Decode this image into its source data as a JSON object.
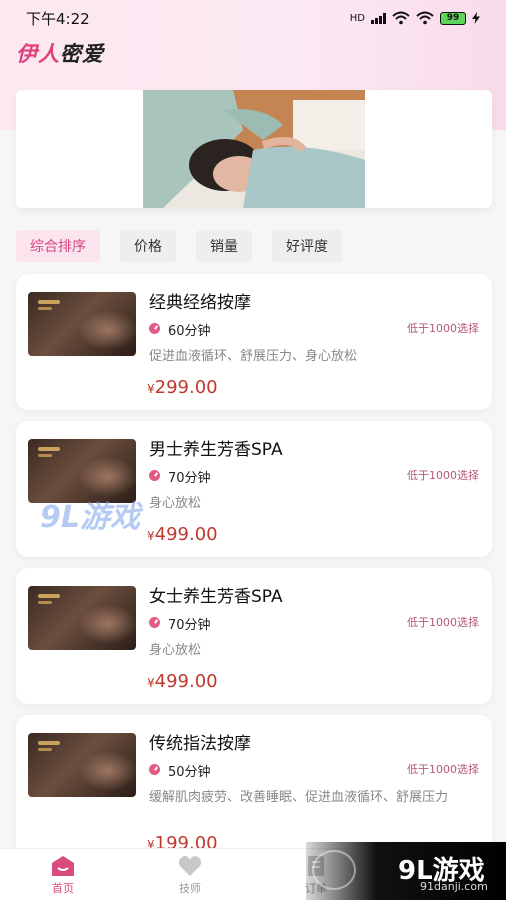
{
  "status": {
    "time": "下午4:22",
    "network": "HD",
    "battery": "99"
  },
  "app": {
    "title_part1": "伊人",
    "title_part2": "密爱"
  },
  "filters": [
    {
      "label": "综合排序",
      "active": true
    },
    {
      "label": "价格",
      "active": false
    },
    {
      "label": "销量",
      "active": false
    },
    {
      "label": "好评度",
      "active": false
    }
  ],
  "services": [
    {
      "name": "经典经络按摩",
      "duration": "60分钟",
      "choose": "低于1000选择",
      "desc": "促进血液循环、舒展压力、身心放松",
      "currency": "¥",
      "price": "299.00"
    },
    {
      "name": "男士养生芳香SPA",
      "duration": "70分钟",
      "choose": "低于1000选择",
      "desc": "身心放松",
      "currency": "¥",
      "price": "499.00"
    },
    {
      "name": "女士养生芳香SPA",
      "duration": "70分钟",
      "choose": "低于1000选择",
      "desc": "身心放松",
      "currency": "¥",
      "price": "499.00"
    },
    {
      "name": "传统指法按摩",
      "duration": "50分钟",
      "choose": "低于1000选择",
      "desc": "缓解肌肉疲劳、改善睡眠、促进血液循环、舒展压力",
      "currency": "¥",
      "price": "199.00"
    }
  ],
  "tabs": [
    {
      "label": "首页",
      "icon": "home-icon",
      "active": true
    },
    {
      "label": "技师",
      "icon": "heart-icon",
      "active": false
    },
    {
      "label": "订单",
      "icon": "order-icon",
      "active": false
    }
  ],
  "watermark": {
    "main": "9L游戏",
    "sub": "91danji.com",
    "overlay": "9L游戏"
  },
  "colors": {
    "accent": "#d94a7f",
    "price": "#c0392b",
    "choose": "#b5577a"
  }
}
